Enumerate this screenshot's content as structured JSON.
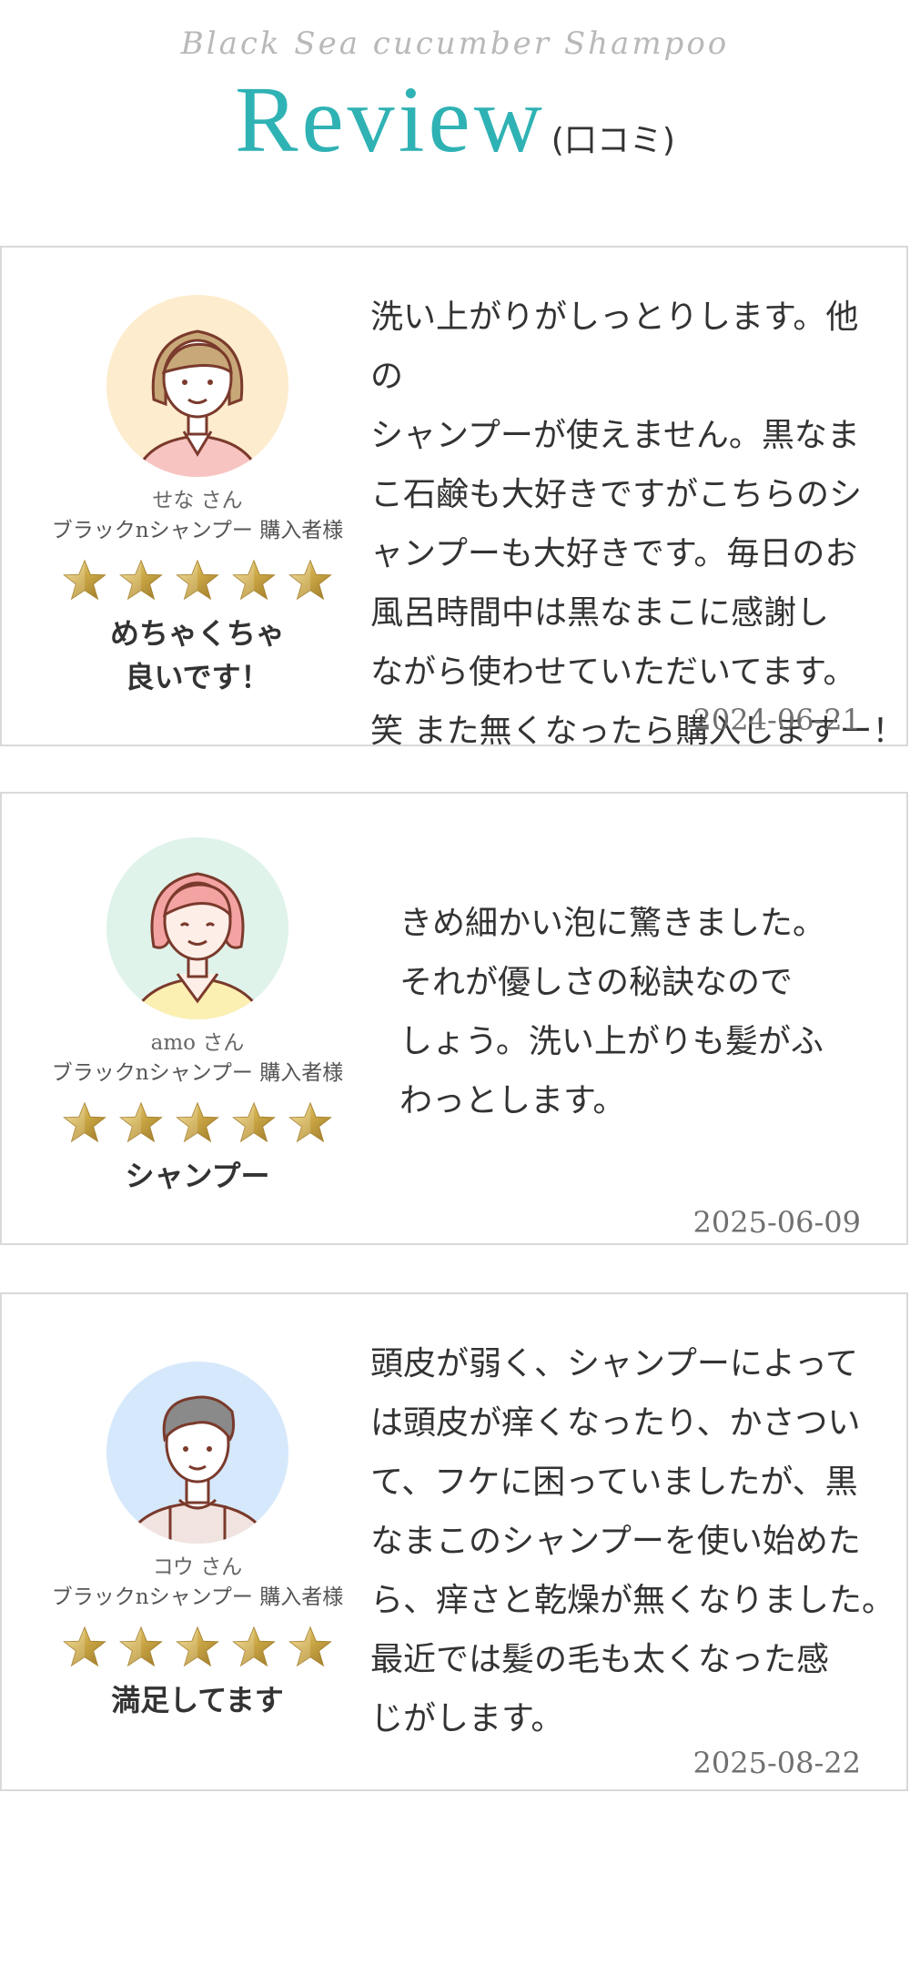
{
  "header": {
    "subtitle": "Black Sea cucumber Shampoo",
    "title": "Review",
    "title_sub": "(口コミ)"
  },
  "colors": {
    "accent": "#2fb2b4",
    "star": "#c9a544",
    "border": "#d9d9d9"
  },
  "reviews": [
    {
      "name": "せな さん",
      "buyer": "ブラックnシャンプー 購入者様",
      "rating": 5,
      "headline_1": "めちゃくちゃ",
      "headline_2": "良いです！",
      "lines": [
        "洗い上がりがしっとりします。他の",
        "シャンプーが使えません。黒なま",
        "こ石鹸も大好きですがこちらのシ",
        "ャンプーも大好きです。毎日のお",
        "風呂時間中は黒なまこに感謝し",
        "ながら使わせていただいてます。",
        "笑 また無くなったら購入しますー！"
      ],
      "date": "2024-06-21",
      "avatar_icon": "woman-blonde-hair-avatar-icon"
    },
    {
      "name": "amo さん",
      "buyer": "ブラックnシャンプー 購入者様",
      "rating": 5,
      "headline_1": "シャンプー",
      "lines": [
        "きめ細かい泡に驚きました。",
        "それが優しさの秘訣なので",
        "しょう。洗い上がりも髪がふ",
        "わっとします。"
      ],
      "date": "2025-06-09",
      "avatar_icon": "woman-pink-hair-avatar-icon"
    },
    {
      "name": "コウ さん",
      "buyer": "ブラックnシャンプー 購入者様",
      "rating": 5,
      "headline_1": "満足してます",
      "lines": [
        "頭皮が弱く、シャンプーによって",
        "は頭皮が痒くなったり、かさつい",
        "て、フケに困っていましたが、黒",
        "なまこのシャンプーを使い始めた",
        "ら、痒さと乾燥が無くなりました。",
        "最近では髪の毛も太くなった感",
        "じがします。"
      ],
      "date": "2025-08-22",
      "avatar_icon": "man-gray-hair-avatar-icon"
    }
  ]
}
